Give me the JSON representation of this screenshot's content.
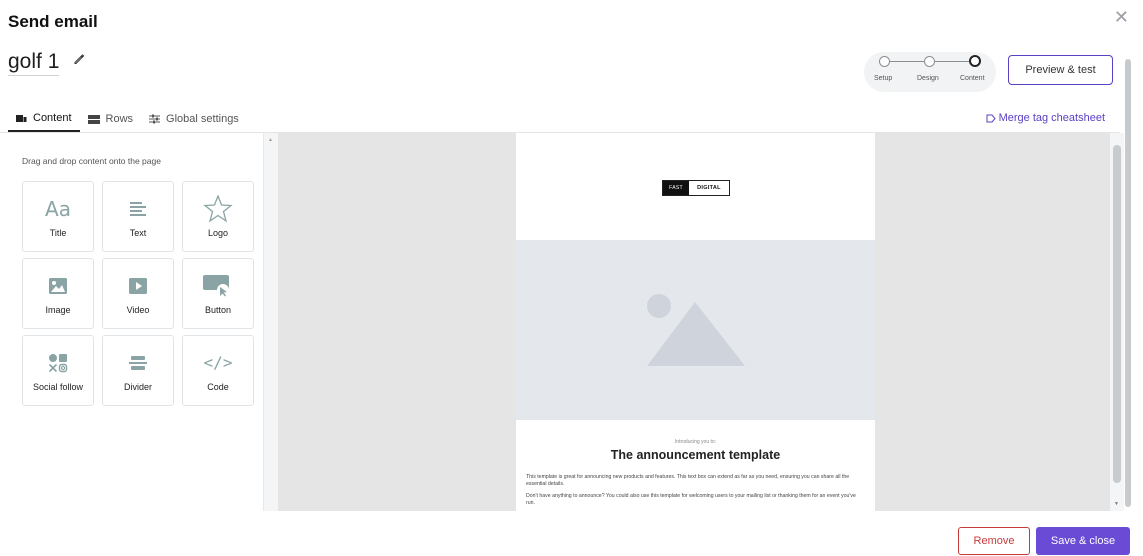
{
  "header": {
    "title": "Send email",
    "close_icon": "close-icon"
  },
  "campaign": {
    "name": "golf 1",
    "edit_icon": "pencil-icon"
  },
  "stepper": {
    "steps": [
      {
        "label": "Setup",
        "state": "complete"
      },
      {
        "label": "Design",
        "state": "complete"
      },
      {
        "label": "Content",
        "state": "active"
      }
    ]
  },
  "toolbar": {
    "preview_label": "Preview & test",
    "merge_label": "Merge tag cheatsheet"
  },
  "tabs": [
    {
      "label": "Content",
      "icon": "content-blocks-icon",
      "active": true
    },
    {
      "label": "Rows",
      "icon": "rows-icon",
      "active": false
    },
    {
      "label": "Global settings",
      "icon": "sliders-icon",
      "active": false
    }
  ],
  "panel": {
    "hint": "Drag and drop content onto the page",
    "blocks": [
      {
        "label": "Title",
        "icon": "title-icon"
      },
      {
        "label": "Text",
        "icon": "text-lines-icon"
      },
      {
        "label": "Logo",
        "icon": "star-icon"
      },
      {
        "label": "Image",
        "icon": "image-icon"
      },
      {
        "label": "Video",
        "icon": "video-play-icon"
      },
      {
        "label": "Button",
        "icon": "button-click-icon"
      },
      {
        "label": "Social follow",
        "icon": "social-icons-icon"
      },
      {
        "label": "Divider",
        "icon": "divider-icon"
      },
      {
        "label": "Code",
        "icon": "code-icon"
      }
    ]
  },
  "email": {
    "logo_left": "FAST",
    "logo_right": "DIGITAL",
    "intro": "Introducing you to:",
    "heading": "The announcement template",
    "paragraph1": "This template is great for announcing new products and features. This text box can extend as far as you need, ensuring you can share all the essential details.",
    "paragraph2": "Don't have anything to announce? You could also use this template for welcoming users to your mailing list or thanking them for an event you've run."
  },
  "footer": {
    "remove_label": "Remove",
    "save_label": "Save & close"
  },
  "colors": {
    "accent": "#6a4bd6",
    "danger": "#c53b3b",
    "block_icon": "#8aa4a5",
    "canvas_bg": "#e5e5e6"
  }
}
